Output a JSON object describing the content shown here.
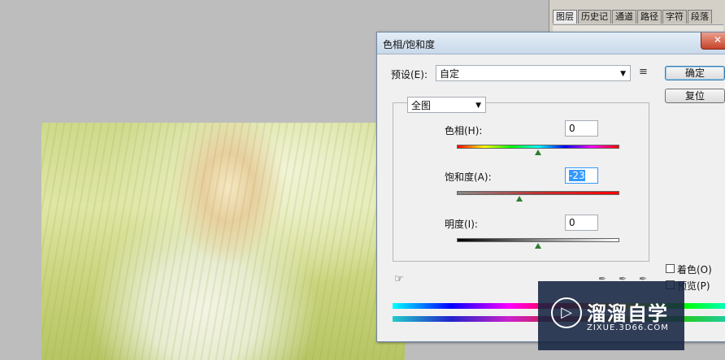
{
  "panel": {
    "tabs": [
      "图层",
      "历史记",
      "通道",
      "路径",
      "字符",
      "段落"
    ]
  },
  "dialog": {
    "title": "色相/饱和度",
    "close_glyph": "✕",
    "preset_label": "预设(E):",
    "preset_value": "自定",
    "preset_menu_icon": "menu-icon",
    "ok_label": "确定",
    "reset_label": "复位",
    "channel_value": "全图",
    "hue": {
      "label": "色相(H):",
      "value": "0",
      "fraction": 0.5
    },
    "saturation": {
      "label": "饱和度(A):",
      "value": "-23",
      "fraction": 0.385
    },
    "lightness": {
      "label": "明度(I):",
      "value": "0",
      "fraction": 0.5
    },
    "colorize_label": "着色(O)",
    "preview_label": "预览(P)",
    "preview_checked": false,
    "colorize_checked": false
  },
  "watermark": {
    "logo_glyph": "▷",
    "title": "溜溜自学",
    "url": "ZIXUE.3D66.COM"
  },
  "colors": {
    "title_bg": "#c9d9ea",
    "close": "#c7432b",
    "thumb": "#2f7d32",
    "selection": "#3399ff"
  }
}
